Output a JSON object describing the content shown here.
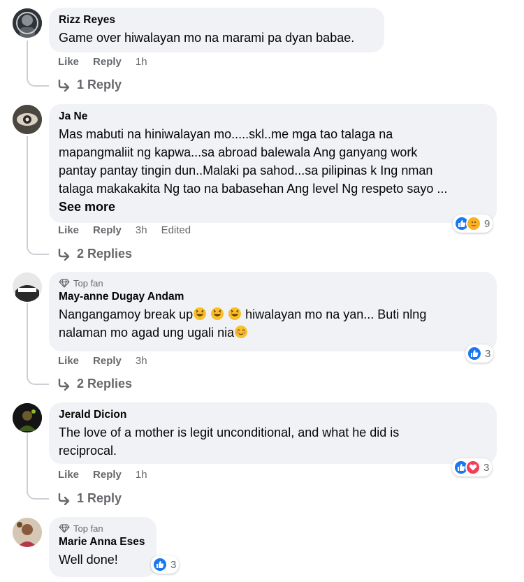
{
  "comments": [
    {
      "author": "Rizz Reyes",
      "text": "Game over hiwalayan mo na marami pa dyan babae.",
      "like_label": "Like",
      "reply_label": "Reply",
      "time": "1h",
      "replies_label": "1 Reply"
    },
    {
      "author": "Ja Ne",
      "lines": [
        "Mas mabuti na hiniwalayan mo.....skl..me mga tao talaga na",
        "mapangmaliit ng kapwa...sa abroad balewala Ang ganyang work",
        "pantay pantay tingin dun..Malaki pa sahod...sa pilipinas k Ing nman",
        "talaga makakakita Ng tao na babasehan Ang level Ng respeto sayo ..."
      ],
      "see_more": "See more",
      "like_label": "Like",
      "reply_label": "Reply",
      "time": "3h",
      "edited": "Edited",
      "reaction_count": "9",
      "replies_label": "2 Replies"
    },
    {
      "badge": "Top fan",
      "author": "May-anne Dugay Andam",
      "line1": "Nangangamoy break up",
      "line1_end": " hiwalayan mo na yan... Buti nlng",
      "line2": "nalaman mo agad ung ugali nia",
      "like_label": "Like",
      "reply_label": "Reply",
      "time": "3h",
      "reaction_count": "3",
      "replies_label": "2 Replies"
    },
    {
      "author": "Jerald Dicion",
      "lines": [
        "The love of a mother is legit unconditional, and what he did is",
        "reciprocal."
      ],
      "like_label": "Like",
      "reply_label": "Reply",
      "time": "1h",
      "reaction_count": "3",
      "replies_label": "1 Reply"
    },
    {
      "badge": "Top fan",
      "author": "Marie Anna Eses",
      "text": "Well done!",
      "reaction_count": "3"
    }
  ],
  "colors": {
    "like_blue": "#1877f2",
    "love_red": "#f33e58",
    "care_yellow": "#f7b125",
    "bubble_bg": "#f0f2f5",
    "meta_gray": "#65676b"
  },
  "icons": [
    "reply-arrow-icon",
    "like-reaction-icon",
    "love-reaction-icon",
    "care-reaction-icon",
    "laugh-emoji-icon",
    "blush-emoji-icon",
    "top-fan-diamond-icon"
  ]
}
